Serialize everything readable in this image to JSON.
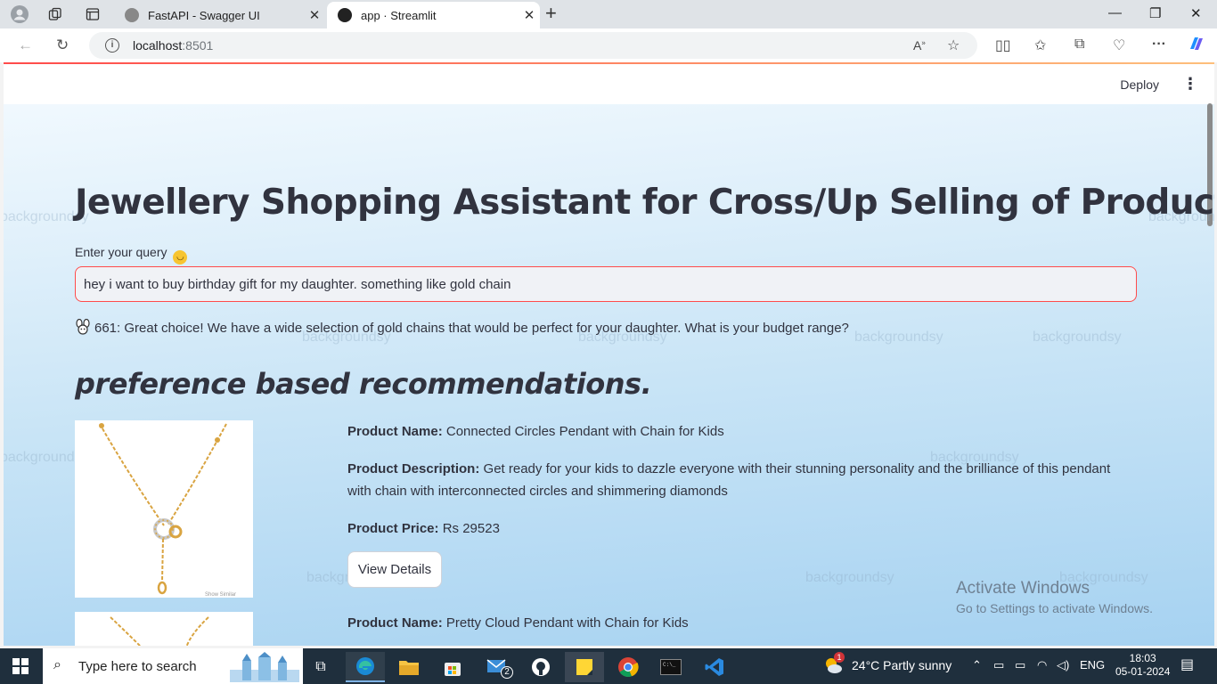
{
  "browser": {
    "tabs": [
      {
        "title": "FastAPI - Swagger UI",
        "active": false
      },
      {
        "title": "app · Streamlit",
        "active": true
      }
    ],
    "url_host": "localhost",
    "url_port": ":8501"
  },
  "streamlit": {
    "deploy_label": "Deploy"
  },
  "page": {
    "title": "Jewellery Shopping Assistant for Cross/Up Selling of Product.",
    "query_label": "Enter your query",
    "query_value": "hey i want to buy birthday gift for my daughter. something like gold chain",
    "response": "661: Great choice! We have a wide selection of gold chains that would be perfect for your daughter. What is your budget range?",
    "recommendations_heading": "preference based recommendations.",
    "labels": {
      "name": "Product Name:",
      "description": "Product Description:",
      "price": "Product Price:"
    },
    "products": [
      {
        "name": "Connected Circles Pendant with Chain for Kids",
        "description": "Get ready for your kids to dazzle everyone with their stunning personality and the brilliance of this pendant with chain with interconnected circles and shimmering diamonds",
        "price": "Rs 29523",
        "button": "View Details"
      },
      {
        "name": "Pretty Cloud Pendant with Chain for Kids"
      }
    ],
    "image_caption": "Show Similar"
  },
  "watermark_text": "backgroundsy",
  "activation": {
    "title": "Activate Windows",
    "subtitle": "Go to Settings to activate Windows."
  },
  "taskbar": {
    "search_placeholder": "Type here to search",
    "mail_badge": "2",
    "weather_badge": "1",
    "weather": "24°C  Partly sunny",
    "language": "ENG",
    "time": "18:03",
    "date": "05-01-2024"
  },
  "colors": {
    "accent": "#ff4b4b",
    "text": "#31333f",
    "taskbar": "#1f2f3d"
  }
}
